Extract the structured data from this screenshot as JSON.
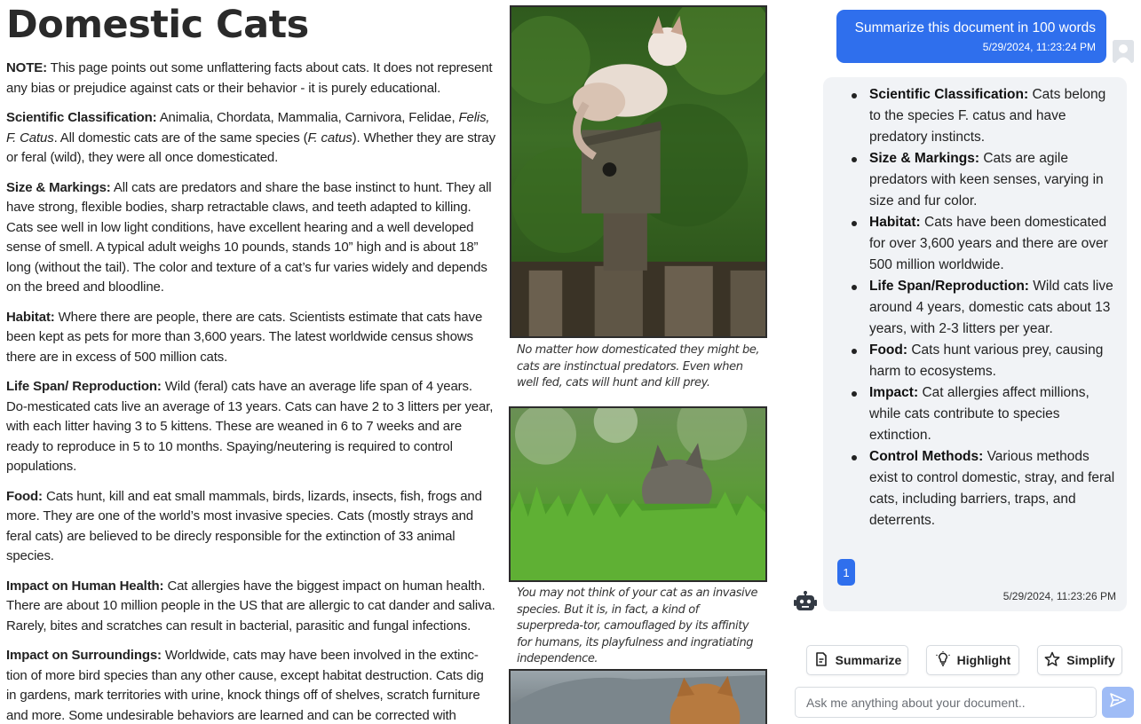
{
  "document": {
    "title": "Domestic Cats",
    "note_label": "NOTE:",
    "note_text": "This page points out some unflattering facts about cats. It does not represent any bias or prejudice against cats or their behavior - it is purely educational.",
    "sections": [
      {
        "heading": "Scientific Classification:",
        "text_before": "Animalia, Chordata, Mammalia, Carnivora, Felidae,",
        "italic": "Felis, F. Catus",
        "text_mid": ". All domestic cats are of the same species (",
        "italic2": "F. catus",
        "text_after": "). Whether they are stray or feral (wild), they were all once domesticated."
      },
      {
        "heading": "Size & Markings:",
        "text": "All cats are predators and share the base instinct to hunt. They all have strong, flexible bodies, sharp retractable claws, and teeth adapted to killing. Cats see well in low light conditions, have excellent hearing and a well developed sense of smell. A typical adult weighs 10 pounds, stands 10” high and is about 18” long (without the tail). The color and texture of a cat’s fur varies widely and depends on the breed and bloodline."
      },
      {
        "heading": "Habitat:",
        "text": "Where there are people, there are cats. Scientists estimate that cats have been kept as pets for more than 3,600 years. The latest worldwide census shows there are in excess of 500 million cats."
      },
      {
        "heading": "Life Span/ Reproduction:",
        "text": "Wild (feral) cats have an average life span of 4 years. Do-mesticated cats live an average of 13 years. Cats can have 2 to 3 litters per year, with each litter having 3 to 5 kittens. These are weaned in 6 to 7 weeks and are ready to reproduce in 5 to 10 months. Spaying/neutering is required to control populations."
      },
      {
        "heading": "Food:",
        "text": "Cats hunt, kill and eat small mammals, birds, lizards, insects, fish, frogs and more. They are one of the world’s most invasive species. Cats (mostly strays and feral cats) are believed to be direcly responsible for the extinction of 33 animal species."
      },
      {
        "heading": "Impact on Human Health:",
        "text": "Cat allergies have the biggest impact on human health. There are about 10 million people in the US that are allergic to cat dander and saliva. Rarely, bites and scratches can result in bacterial, parasitic and fungal infections."
      },
      {
        "heading": "Impact on Surroundings:",
        "text": "Worldwide, cats may have been involved in the extinc-tion of more bird species than any other cause, except habitat destruction. Cats dig in gardens, mark territories with urine, knock things off of shelves, scratch furniture and more. Some undesirable behaviors are learned and can be corrected with training. Others are instinctual and require more involved solutions to correct."
      }
    ],
    "captions": [
      "No matter how domesticated they might be, cats are instinctual predators. Even when well fed, cats will hunt and kill prey.",
      "You may not think of your cat as an invasive species. But it is, in fact, a kind of superpreda-tor, camouflaged by its affinity for humans, its playfulness and ingratiating independence."
    ]
  },
  "chat": {
    "user_message": {
      "text": "Summarize this document in 100 words",
      "timestamp": "5/29/2024, 11:23:24 PM"
    },
    "bot_message": {
      "items": [
        {
          "label": "Scientific Classification:",
          "text": "Cats belong to the species F. catus and have predatory instincts."
        },
        {
          "label": "Size & Markings:",
          "text": "Cats are agile predators with keen senses, varying in size and fur color."
        },
        {
          "label": "Habitat:",
          "text": "Cats have been domesticated for over 3,600 years and there are over 500 million worldwide."
        },
        {
          "label": "Life Span/Reproduction:",
          "text": "Wild cats live around 4 years, domestic cats about 13 years, with 2-3 litters per year."
        },
        {
          "label": "Food:",
          "text": "Cats hunt various prey, causing harm to ecosystems."
        },
        {
          "label": "Impact:",
          "text": "Cat allergies affect millions, while cats contribute to species extinction."
        },
        {
          "label": "Control Methods:",
          "text": "Various methods exist to control domestic, stray, and feral cats, including barriers, traps, and deterrents."
        }
      ],
      "citation": "1",
      "timestamp": "5/29/2024, 11:23:26 PM"
    },
    "actions": {
      "summarize": "Summarize",
      "highlight": "Highlight",
      "simplify": "Simplify"
    },
    "input": {
      "placeholder": "Ask me anything about your document.."
    }
  },
  "colors": {
    "accent": "#2f6fed",
    "send_disabled": "#9fbcf6",
    "bot_bubble": "#f1f3f6"
  },
  "icons": {
    "user_avatar": "user-avatar-icon",
    "bot_avatar": "robot-icon",
    "summarize": "document-icon",
    "highlight": "lightbulb-icon",
    "simplify": "star-icon",
    "send": "send-icon"
  }
}
